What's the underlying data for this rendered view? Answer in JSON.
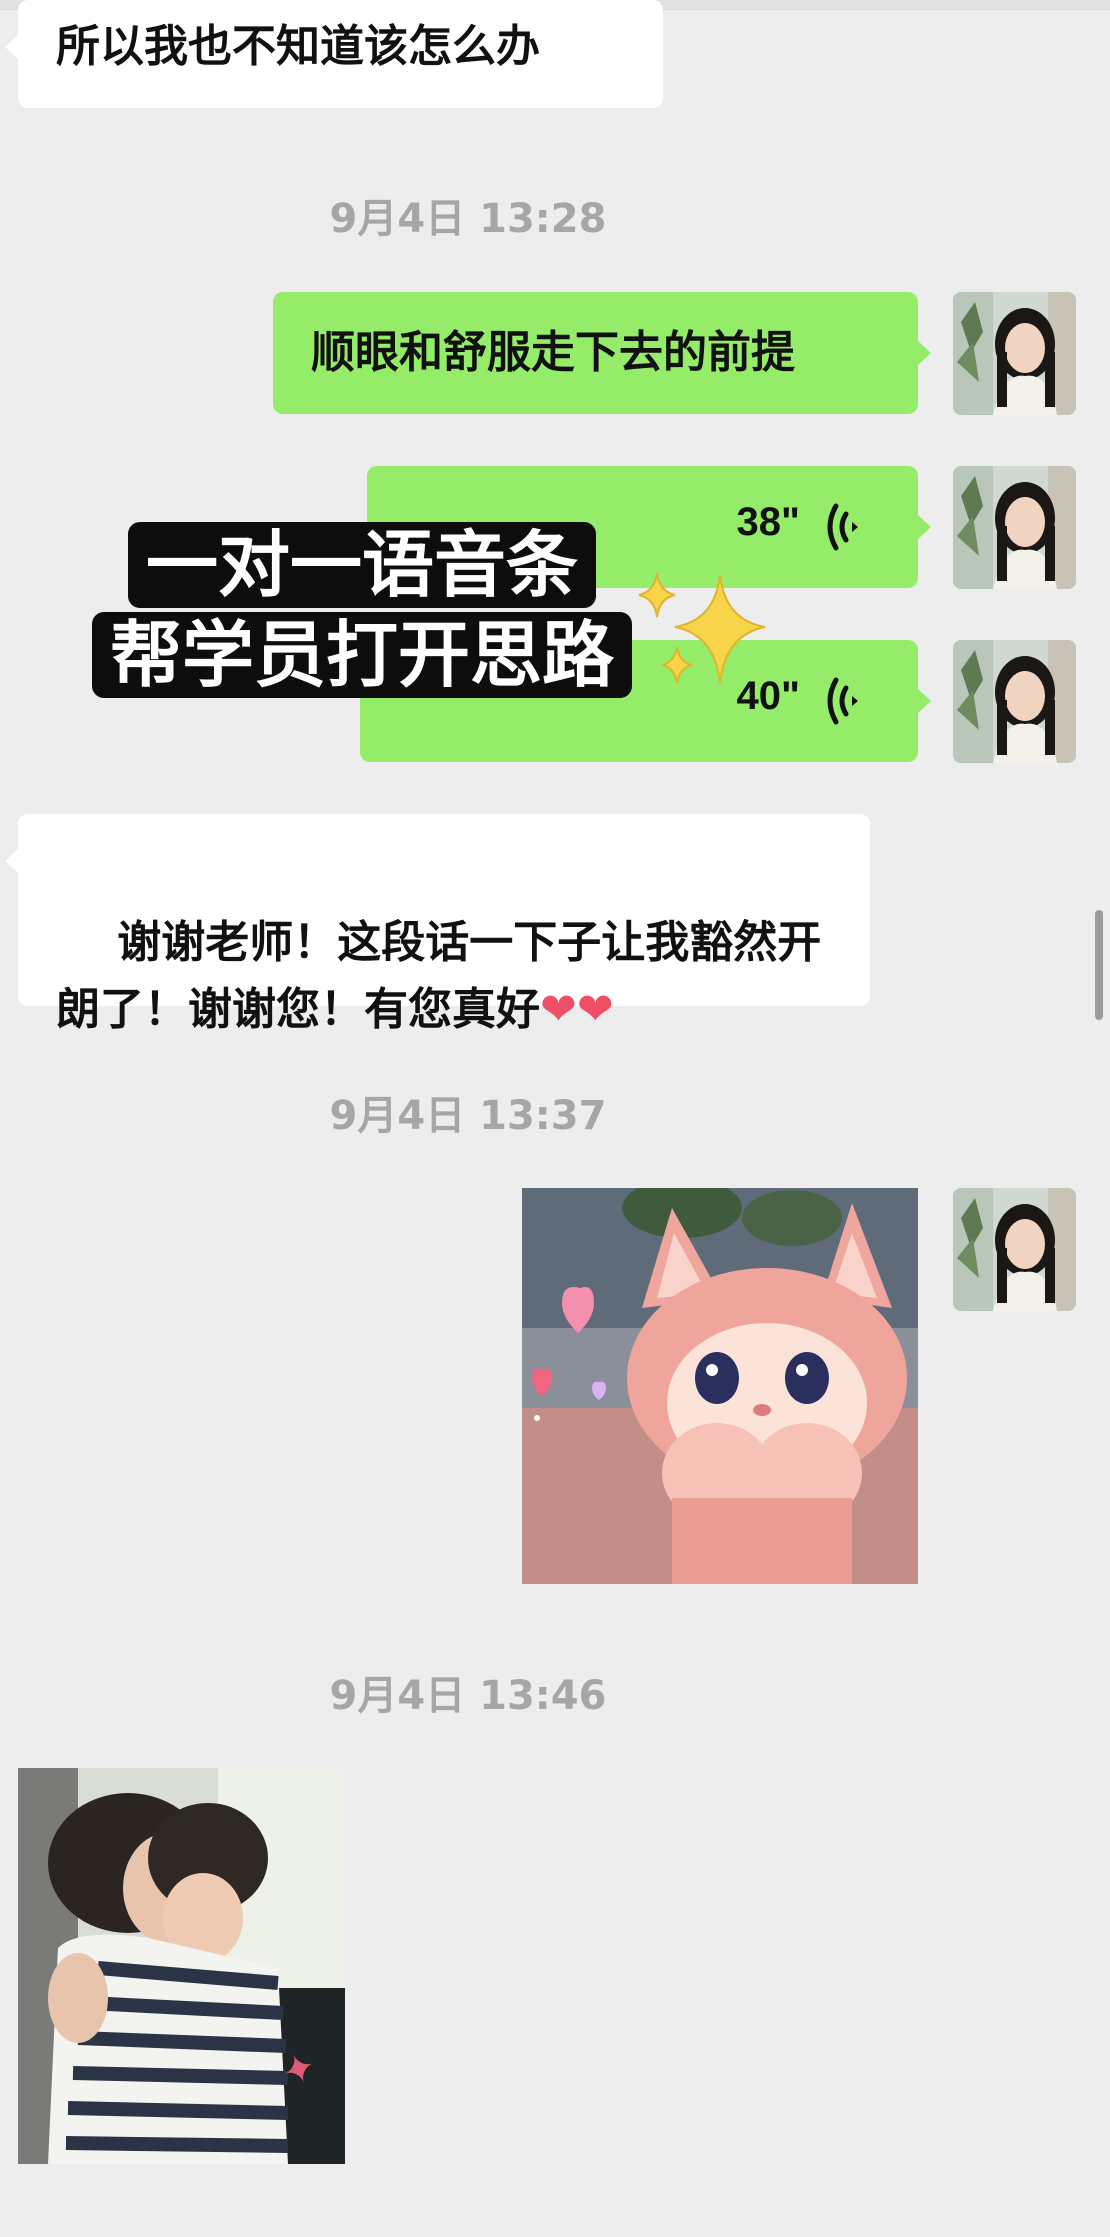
{
  "messages": {
    "m1_text": "所以我也不知道该怎么办",
    "ts1": "9月4日 13:28",
    "m2_text": "顺眼和舒服走下去的前提",
    "voice1_duration": "38\"",
    "voice2_duration": "40\"",
    "m3_text": "谢谢老师！这段话一下子让我豁然开朗了！谢谢您！有您真好",
    "m3_hearts": "❤❤",
    "ts2": "9月4日 13:37",
    "ts3": "9月4日 13:46"
  },
  "overlay": {
    "line1": "一对一语音条",
    "line2": "帮学员打开思路"
  },
  "colors": {
    "background": "#ededed",
    "outgoing_bubble": "#95ec69",
    "incoming_bubble": "#ffffff",
    "timestamp_text": "#a6a6a6"
  },
  "icons": {
    "voice": "voice-wave-icon",
    "sparkles": "sparkles-icon"
  }
}
